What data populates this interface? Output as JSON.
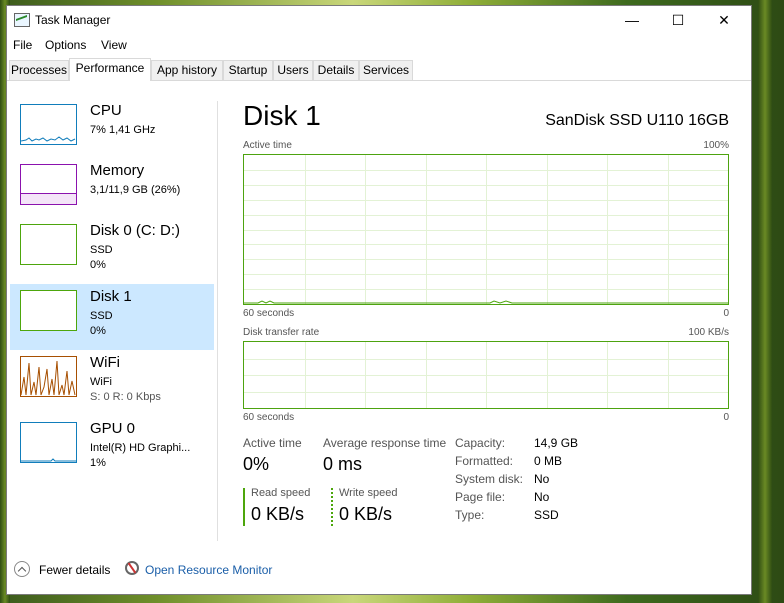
{
  "window": {
    "title": "Task Manager",
    "minimize_glyph": "—",
    "maximize_glyph": "☐",
    "close_glyph": "✕"
  },
  "menu": [
    "File",
    "Options",
    "View"
  ],
  "tabs": [
    "Processes",
    "Performance",
    "App history",
    "Startup",
    "Users",
    "Details",
    "Services"
  ],
  "active_tab": "Performance",
  "sidebar": {
    "items": [
      {
        "name": "CPU",
        "sub1": "7% 1,41 GHz",
        "sub2": "",
        "sub3": "",
        "color": "#117dbb"
      },
      {
        "name": "Memory",
        "sub1": "3,1/11,9 GB (26%)",
        "sub2": "",
        "sub3": "",
        "color": "#8b12ae",
        "level": 0.26
      },
      {
        "name": "Disk 0 (C: D:)",
        "sub1": "SSD",
        "sub2": "0%",
        "sub3": "",
        "color": "#4da60c"
      },
      {
        "name": "Disk 1",
        "sub1": "SSD",
        "sub2": "0%",
        "sub3": "",
        "color": "#4da60c",
        "selected": true
      },
      {
        "name": "WiFi",
        "sub1": "WiFi",
        "sub2": "S: 0 R: 0 Kbps",
        "sub3": "",
        "color": "#a74f01"
      },
      {
        "name": "GPU 0",
        "sub1": "Intel(R) HD Graphi...",
        "sub2": "1%",
        "sub3": "",
        "color": "#117dbb"
      }
    ]
  },
  "main": {
    "title": "Disk 1",
    "model": "SanDisk SSD U110 16GB",
    "graph1": {
      "label": "Active time",
      "max": "100%",
      "time": "60 seconds",
      "min": "0"
    },
    "graph2": {
      "label": "Disk transfer rate",
      "max": "100 KB/s",
      "time": "60 seconds",
      "min": "0"
    },
    "stats": {
      "active_time_label": "Active time",
      "active_time_value": "0%",
      "avg_response_label": "Average response time",
      "avg_response_value": "0 ms",
      "read_speed_label": "Read speed",
      "read_speed_value": "0 KB/s",
      "write_speed_label": "Write speed",
      "write_speed_value": "0 KB/s"
    },
    "details": [
      {
        "label": "Capacity:",
        "value": "14,9 GB"
      },
      {
        "label": "Formatted:",
        "value": "0 MB"
      },
      {
        "label": "System disk:",
        "value": "No"
      },
      {
        "label": "Page file:",
        "value": "No"
      },
      {
        "label": "Type:",
        "value": "SSD"
      }
    ]
  },
  "footer": {
    "fewer_details": "Fewer details",
    "open_resource_monitor": "Open Resource Monitor"
  },
  "colors": {
    "accent_link": "#1a5ea8",
    "disk_green": "#4da60c",
    "selected_bg": "#cce8ff"
  }
}
